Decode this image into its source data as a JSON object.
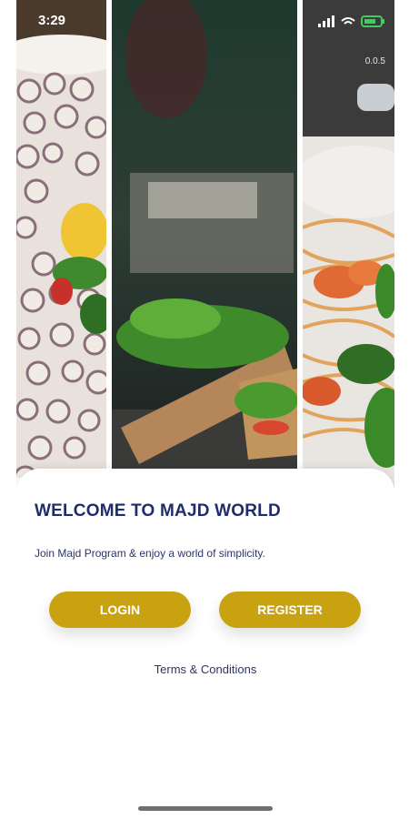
{
  "status_bar": {
    "time": "3:29",
    "zoom_readout": "0.0.5"
  },
  "colors": {
    "brand_gold": "#c9a212",
    "title_navy": "#1f2d6b"
  },
  "welcome": {
    "title": "WELCOME TO MAJD WORLD",
    "subtitle": "Join Majd Program & enjoy a world of simplicity."
  },
  "actions": {
    "login_label": "LOGIN",
    "register_label": "REGISTER",
    "terms_label": "Terms & Conditions"
  },
  "icons": {
    "location": "location-arrow-icon",
    "signal": "signal-icon",
    "wifi": "wifi-icon",
    "battery": "battery-icon",
    "home_indicator": "home-indicator"
  }
}
